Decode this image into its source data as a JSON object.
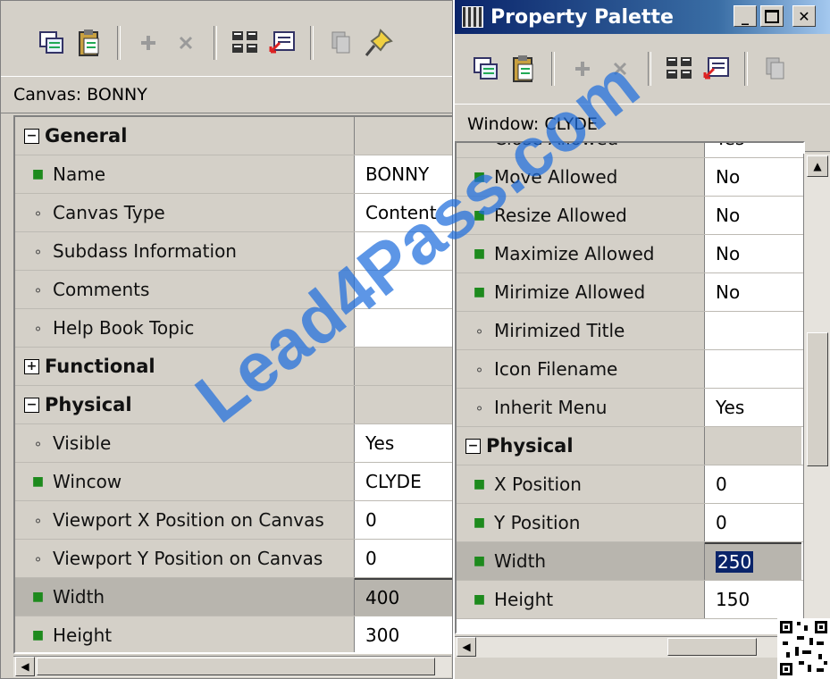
{
  "left_palette": {
    "context_label": "Canvas: BONNY",
    "rows": [
      {
        "type": "group",
        "toggle": "−",
        "name": "General",
        "value": ""
      },
      {
        "type": "prop",
        "glyph": "green",
        "name": "Name",
        "value": "BONNY"
      },
      {
        "type": "prop",
        "glyph": "dot",
        "name": "Canvas Type",
        "value": "Content"
      },
      {
        "type": "prop",
        "glyph": "dot",
        "name": "Subdass Information",
        "value": ""
      },
      {
        "type": "prop",
        "glyph": "dot",
        "name": "Comments",
        "value": ""
      },
      {
        "type": "prop",
        "glyph": "dot",
        "name": "Help Book Topic",
        "value": ""
      },
      {
        "type": "group",
        "toggle": "+",
        "name": "Functional",
        "value": ""
      },
      {
        "type": "group",
        "toggle": "−",
        "name": "Physical",
        "value": ""
      },
      {
        "type": "prop",
        "glyph": "dot",
        "name": "Visible",
        "value": "Yes"
      },
      {
        "type": "prop",
        "glyph": "green",
        "name": "Wincow",
        "value": "CLYDE"
      },
      {
        "type": "prop",
        "glyph": "dot",
        "name": "Viewport X Position on Canvas",
        "value": "0"
      },
      {
        "type": "prop",
        "glyph": "dot",
        "name": "Viewport Y Position on Canvas",
        "value": "0"
      },
      {
        "type": "prop",
        "glyph": "green",
        "name": "Width",
        "value": "400",
        "selected": true
      },
      {
        "type": "prop",
        "glyph": "green",
        "name": "Height",
        "value": "300"
      }
    ]
  },
  "right_palette": {
    "title": "Property Palette",
    "context_label": "Window: CLYDE",
    "rows": [
      {
        "type": "prop",
        "glyph": "dot",
        "name": "Close Allowed",
        "value": "Yes"
      },
      {
        "type": "prop",
        "glyph": "green",
        "name": "Move Allowed",
        "value": "No"
      },
      {
        "type": "prop",
        "glyph": "green",
        "name": "Resize Allowed",
        "value": "No"
      },
      {
        "type": "prop",
        "glyph": "green",
        "name": "Maximize Allowed",
        "value": "No"
      },
      {
        "type": "prop",
        "glyph": "green",
        "name": "Mirimize Allowed",
        "value": "No"
      },
      {
        "type": "prop",
        "glyph": "dot",
        "name": "Mirimized Title",
        "value": ""
      },
      {
        "type": "prop",
        "glyph": "dot",
        "name": "Icon Filename",
        "value": ""
      },
      {
        "type": "prop",
        "glyph": "dot",
        "name": "Inherit Menu",
        "value": "Yes"
      },
      {
        "type": "group",
        "toggle": "−",
        "name": "Physical",
        "value": ""
      },
      {
        "type": "prop",
        "glyph": "green",
        "name": "X Position",
        "value": "0"
      },
      {
        "type": "prop",
        "glyph": "green",
        "name": "Y Position",
        "value": "0"
      },
      {
        "type": "prop",
        "glyph": "green",
        "name": "Width",
        "value": "250",
        "selected": true
      },
      {
        "type": "prop",
        "glyph": "green",
        "name": "Height",
        "value": "150"
      }
    ]
  },
  "watermark": "Lead4Pass.com"
}
